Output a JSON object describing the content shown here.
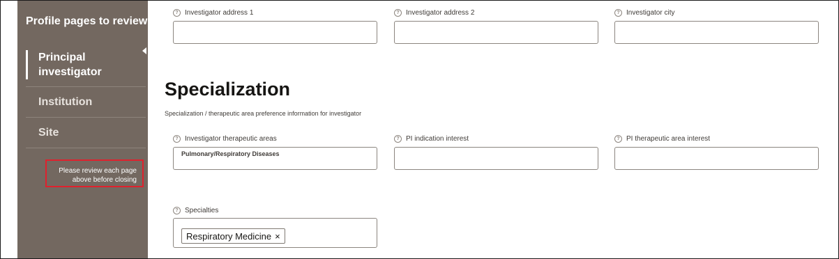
{
  "sidebar": {
    "title": "Profile pages to review",
    "items": [
      {
        "label": "Principal investigator"
      },
      {
        "label": "Institution"
      },
      {
        "label": "Site"
      }
    ],
    "notice": "Please review each page above before closing"
  },
  "address_fields": [
    {
      "label": "Investigator address 1",
      "value": ""
    },
    {
      "label": "Investigator address 2",
      "value": ""
    },
    {
      "label": "Investigator city",
      "value": ""
    }
  ],
  "specialization": {
    "title": "Specialization",
    "description": "Specialization / therapeutic area preference information for investigator",
    "fields": [
      {
        "label": "Investigator therapeutic areas",
        "value": "Pulmonary/Respiratory Diseases"
      },
      {
        "label": "PI indication interest",
        "value": ""
      },
      {
        "label": "PI therapeutic area interest",
        "value": ""
      }
    ],
    "specialties": {
      "label": "Specialties",
      "chips": [
        "Respiratory Medicine"
      ],
      "remove_symbol": "×"
    }
  },
  "help_icon_glyph": "?",
  "colors": {
    "sidebar_bg": "#736860",
    "notice_border": "#e0212d",
    "field_border": "#8b857f"
  }
}
